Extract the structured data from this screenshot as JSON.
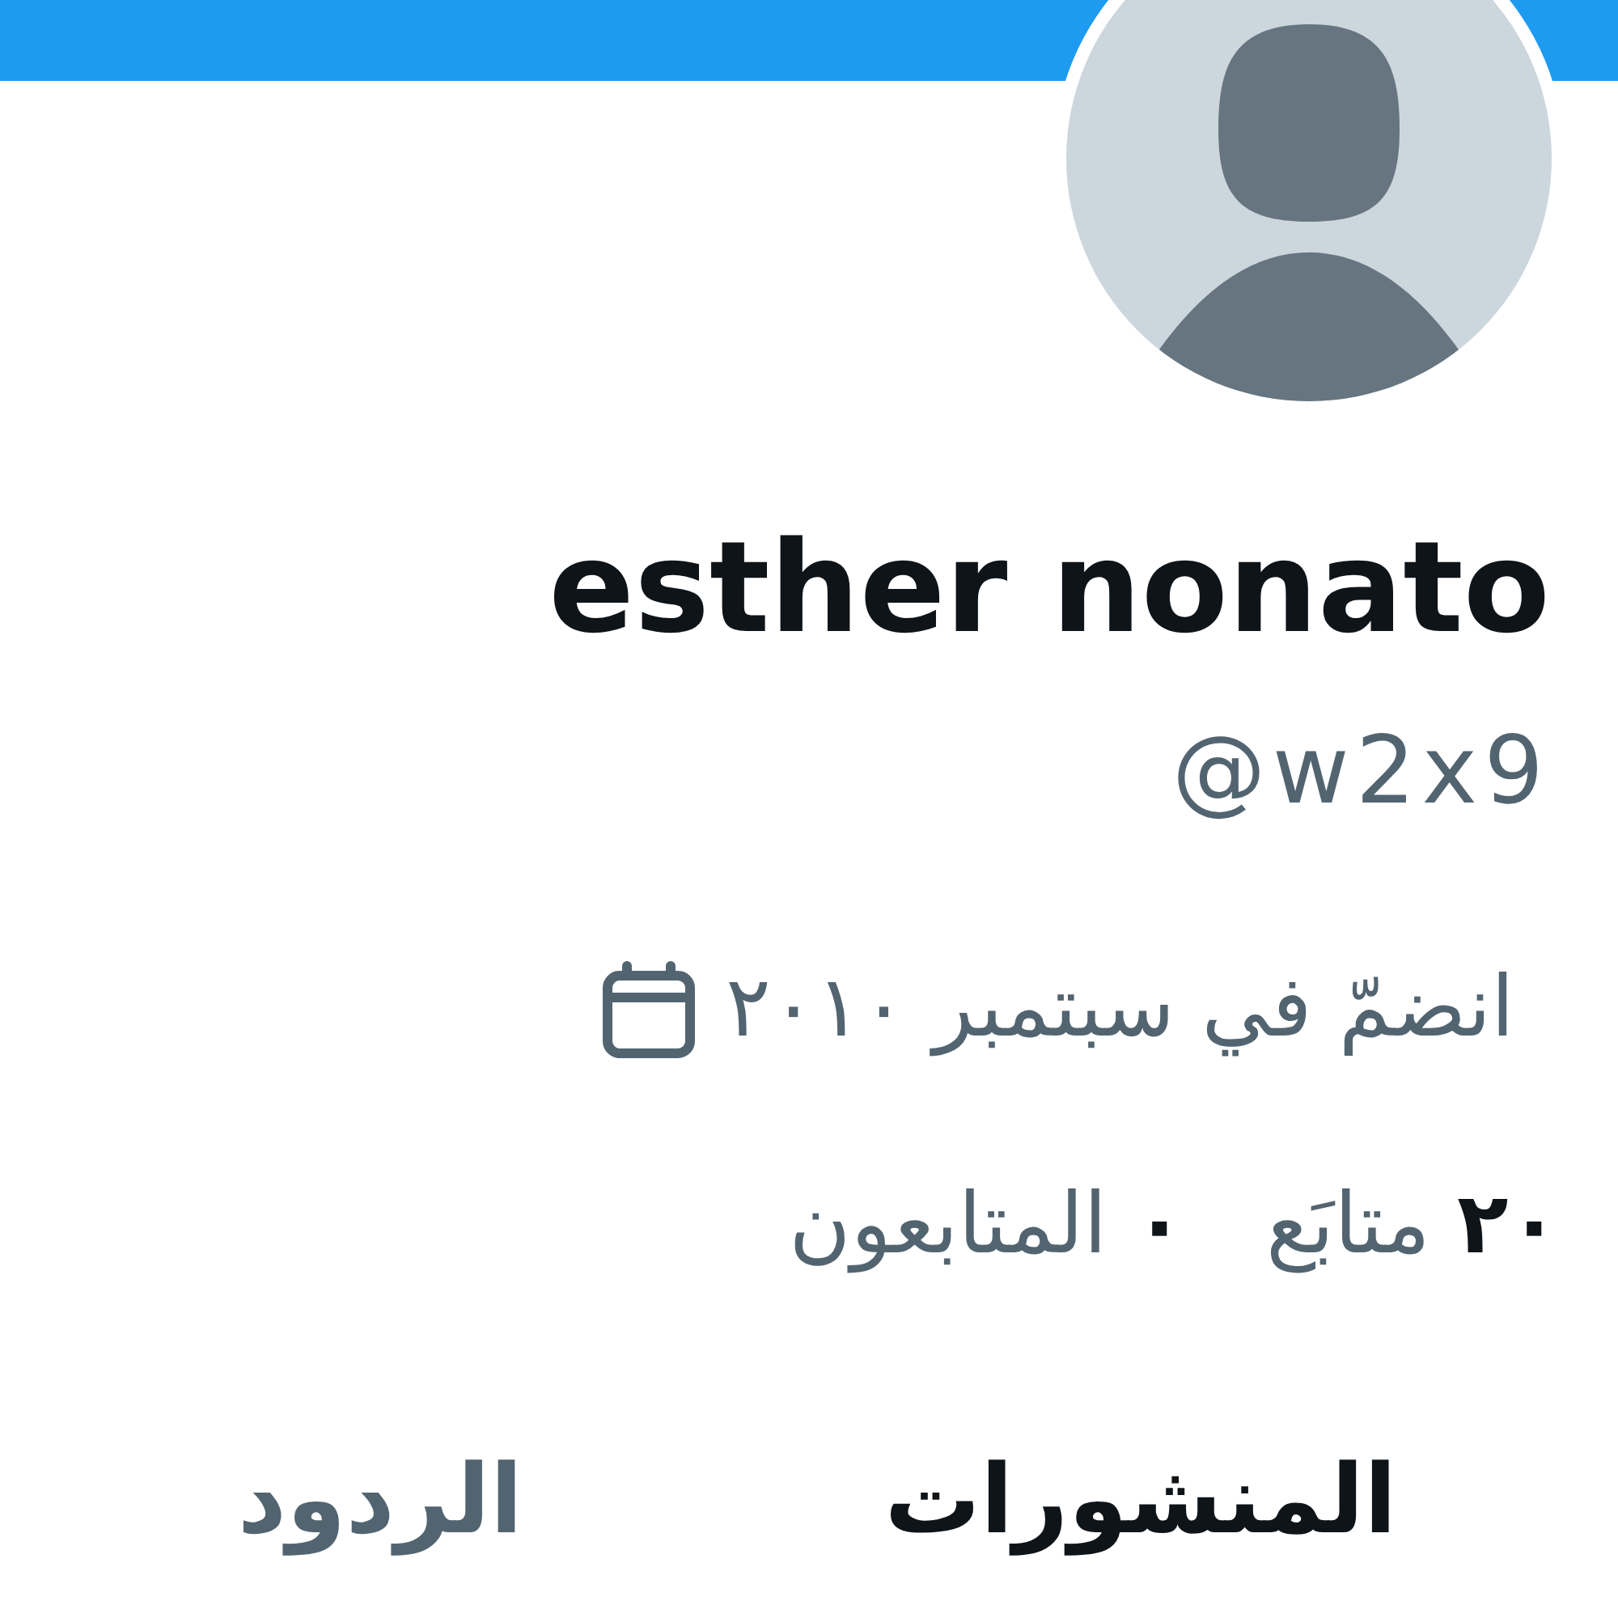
{
  "profile": {
    "name": "esther nonato",
    "handle": "@w2x9",
    "joined": "انضمّ في سبتمبر ٢٠١٠"
  },
  "stats": [
    {
      "count": "٢٠",
      "label": "متابَع"
    },
    {
      "count": "٠",
      "label": "المتابعون"
    }
  ],
  "tabs": [
    {
      "label": "المنشورات",
      "selected": true
    },
    {
      "label": "الردود",
      "selected": false
    }
  ]
}
